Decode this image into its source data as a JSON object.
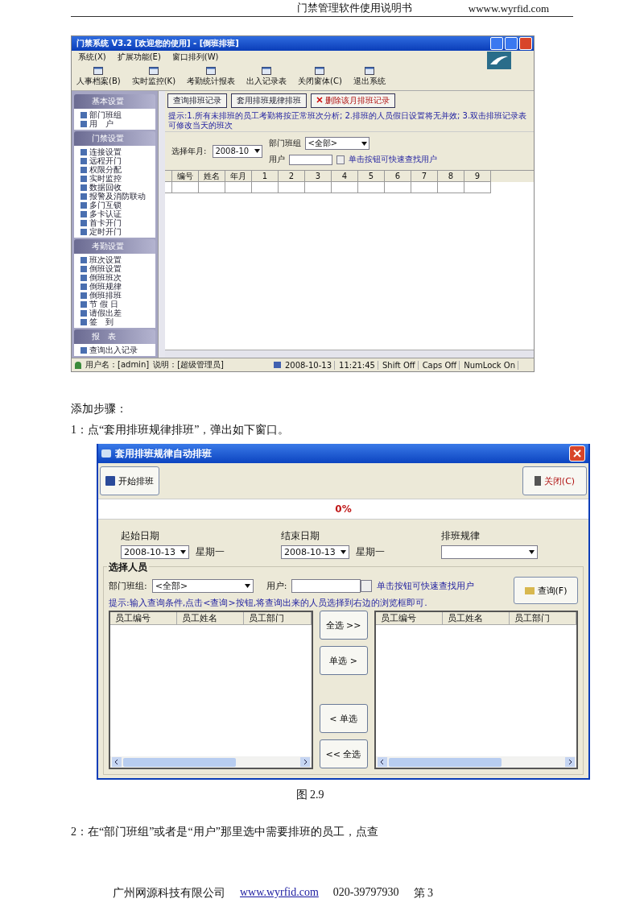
{
  "page_header": {
    "title": "门禁管理软件使用说明书",
    "site": "wwww.wyrfid.com"
  },
  "main_window": {
    "title": "门禁系统 V3.2 [欢迎您的使用] - [倒班排班]",
    "menu": [
      "系统(X)",
      "扩展功能(E)",
      "窗口排列(W)"
    ],
    "toolbar": [
      "人事档案(B)",
      "实时监控(K)",
      "考勤统计报表",
      "出入记录表",
      "关闭窗体(C)",
      "退出系统"
    ],
    "sidebar": [
      {
        "title": "基本设置",
        "items": [
          "部门班组",
          "用　户"
        ]
      },
      {
        "title": "门禁设置",
        "items": [
          "连接设置",
          "远程开门",
          "权限分配",
          "实时监控",
          "数据回收",
          "报警及消防联动",
          "多门互锁",
          "多卡认证",
          "首卡开门",
          "定时开门"
        ]
      },
      {
        "title": "考勤设置",
        "items": [
          "班次设置",
          "倒班设置",
          "倒班班次",
          "倒班规律",
          "倒班排班",
          "节 假 日",
          "请假出差",
          "签　到"
        ]
      },
      {
        "title": "报　表",
        "items": [
          "查询出入记录"
        ]
      }
    ],
    "actions": [
      {
        "label": "查询排班记录",
        "kind": "plain"
      },
      {
        "label": "套用排班规律排班",
        "kind": "plain"
      },
      {
        "label": "删除该月排班记录",
        "kind": "delete"
      }
    ],
    "hint": "提示:1.所有未排班的员工考勤将按正常班次分析; 2.排班的人员假日设置将无并效; 3.双击排班记录表可修改当天的班次",
    "month_label": "选择年月:",
    "month_value": "2008-10",
    "dept_label": "部门班组",
    "dept_value": "<全部>",
    "user_label": "用户",
    "user_hint": "单击按钮可快速查找用户",
    "columns": [
      "编号",
      "姓名",
      "年月",
      "1",
      "2",
      "3",
      "4",
      "5",
      "6",
      "7",
      "8",
      "9"
    ],
    "status_bar": {
      "user": "用户名：[admin]",
      "note": "说明：[超级管理员]",
      "date": "2008-10-13",
      "time": "11:21:45",
      "shift": "Shift Off",
      "caps": "Caps Off",
      "numlock": "NumLock On"
    }
  },
  "steps_heading": "添加步骤：",
  "step_1": "1：点“套用排班规律排班”，弹出如下窗口。",
  "dialog": {
    "title": "套用排班规律自动排班",
    "start_button": "开始排班",
    "close_button": "关闭(C)",
    "progress": {
      "level": 0,
      "reading": "0%"
    },
    "dates": [
      {
        "label": "起始日期",
        "value": "2008-10-13",
        "weekday": "星期一"
      },
      {
        "label": "结束日期",
        "value": "2008-10-13",
        "weekday": "星期一"
      }
    ],
    "rule_label": "排班规律",
    "group_title": "选择人员",
    "dept_label": "部门班组:",
    "dept_value": "<全部>",
    "user_label": "用户:",
    "user_hint": "单击按钮可快速查找用户",
    "query_button": "查询(F)",
    "hint": "提示:输入查询条件,点击<查询>按钮,将查询出来的人员选择到右边的浏览框即可.",
    "left_columns": [
      "员工编号",
      "员工姓名",
      "员工部门"
    ],
    "right_columns": [
      "员工编号",
      "员工姓名",
      "员工部门"
    ],
    "transfer_buttons": [
      "全选 >>",
      "单选 >",
      "< 单选",
      "<< 全选"
    ]
  },
  "figure_caption": "图 2.9",
  "step_2": "2：在“部门班组”或者是“用户”那里选中需要排班的员工，点查",
  "footer": {
    "company": "广州网源科技有限公司",
    "site": "www.wyrfid.com",
    "phone": "020-39797930",
    "page": "第 3"
  }
}
